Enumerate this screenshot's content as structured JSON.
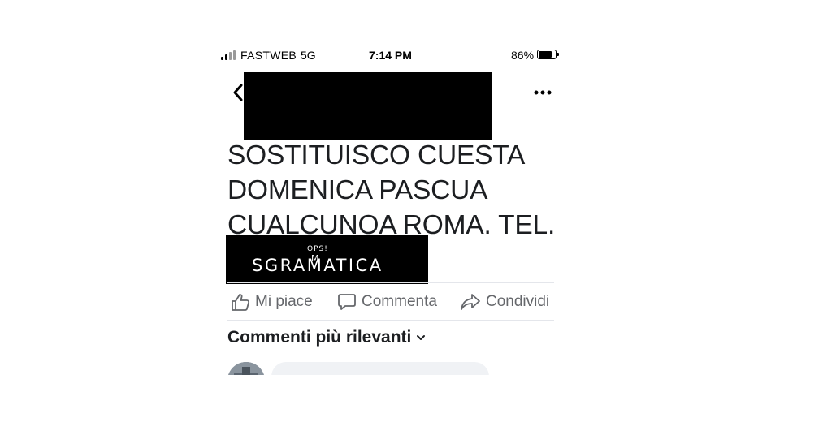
{
  "status_bar": {
    "carrier": "FASTWEB",
    "network": "5G",
    "time": "7:14 PM",
    "battery_percent": "86%",
    "battery_level": 0.86,
    "icons": [
      "signal-icon",
      "battery-icon"
    ]
  },
  "header": {
    "back_icon": "chevron-left-icon",
    "more_icon": "more-dots-icon"
  },
  "post": {
    "lines": [
      "SOSTITUISCO CUESTA",
      "DOMENICA PASCUA",
      "CUALCUNOA ROMA.  TEL."
    ],
    "sticker": {
      "word": "SGRAMATICA",
      "insert_note": "OPS!",
      "insert_letter": "M"
    }
  },
  "actions": {
    "like": "Mi piace",
    "comment": "Commenta",
    "share": "Condividi"
  },
  "comments": {
    "heading": "Commenti più rilevanti"
  },
  "colors": {
    "text": "#1c1e21",
    "secondary": "#65676b",
    "bubble": "#f0f2f5",
    "redaction": "#000000"
  }
}
